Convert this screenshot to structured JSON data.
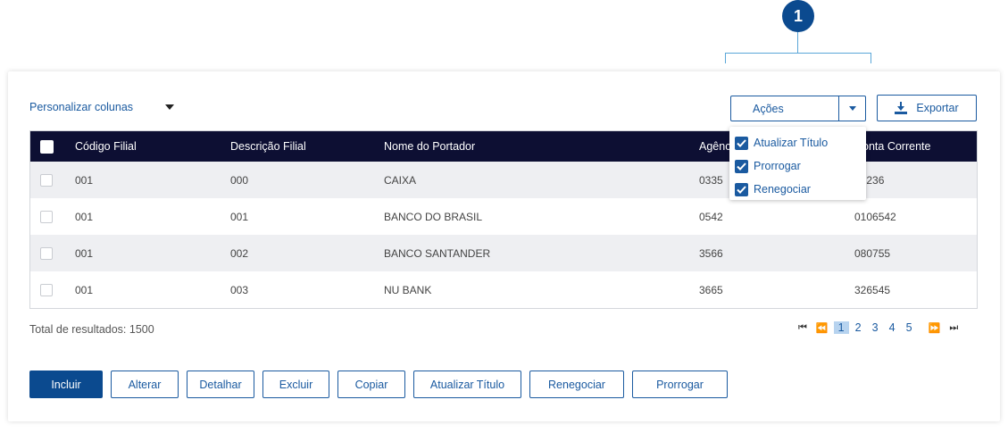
{
  "callout": {
    "number": "1"
  },
  "toolbar": {
    "personalize_label": "Personalizar colunas",
    "acoes_label": "Ações",
    "exportar_label": "Exportar"
  },
  "acoes_menu": {
    "items": [
      {
        "label": "Atualizar Título",
        "checked": true
      },
      {
        "label": "Prorrogar",
        "checked": true
      },
      {
        "label": "Renegociar",
        "checked": true
      }
    ]
  },
  "table": {
    "headers": [
      "Código Filial",
      "Descrição Filial",
      "Nome do Portador",
      "Agência",
      "Conta Corrente"
    ],
    "rows": [
      [
        "001",
        "000",
        "CAIXA",
        "0335",
        "55236"
      ],
      [
        "001",
        "001",
        "BANCO DO BRASIL",
        "0542",
        "0106542"
      ],
      [
        "001",
        "002",
        "BANCO SANTANDER",
        "3566",
        "080755"
      ],
      [
        "001",
        "003",
        "NU BANK",
        "3665",
        "326545"
      ]
    ]
  },
  "footer": {
    "total_label": "Total de resultados: 1500"
  },
  "pagination": {
    "pages": [
      "1",
      "2",
      "3",
      "4",
      "5"
    ],
    "current": "1"
  },
  "buttons": {
    "incluir": "Incluir",
    "alterar": "Alterar",
    "detalhar": "Detalhar",
    "excluir": "Excluir",
    "copiar": "Copiar",
    "atualizar_titulo": "Atualizar Título",
    "renegociar": "Renegociar",
    "prorrogar": "Prorrogar"
  },
  "colors": {
    "primary": "#0b4a8f",
    "header_bg": "#0d0f33",
    "accent": "#1a5aa0"
  }
}
